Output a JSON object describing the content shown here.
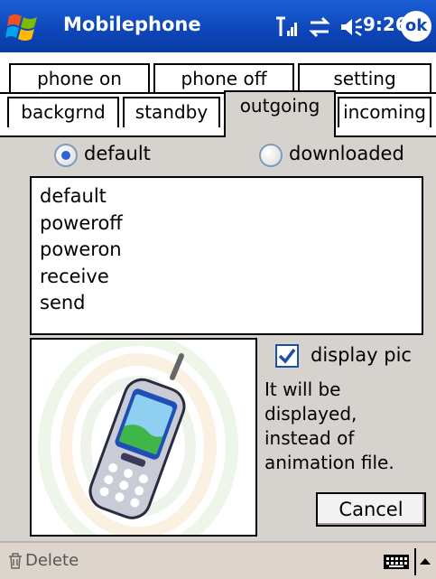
{
  "titlebar": {
    "app_title": "Mobilephone",
    "time": "9:26",
    "ok_label": "ok"
  },
  "tabs": {
    "row1": [
      "phone on",
      "phone off",
      "setting"
    ],
    "row2": [
      "backgrnd",
      "standby",
      "outgoing",
      "incoming"
    ],
    "active": "outgoing"
  },
  "source": {
    "default_label": "default",
    "downloaded_label": "downloaded",
    "selected": "default"
  },
  "sound_list": [
    "default",
    "poweroff",
    "poweron",
    "receive",
    "send"
  ],
  "display_pic": {
    "label": "display pic",
    "checked": true,
    "info": "It will be displayed, instead of animation file."
  },
  "cancel_label": "Cancel",
  "bottombar": {
    "delete_label": "Delete"
  },
  "colors": {
    "titlebar": "#0d45b8",
    "tab_active_bg": "#d6d3ce",
    "radio_dot": "#2d63d6",
    "checkmark": "#1f4ea8"
  }
}
